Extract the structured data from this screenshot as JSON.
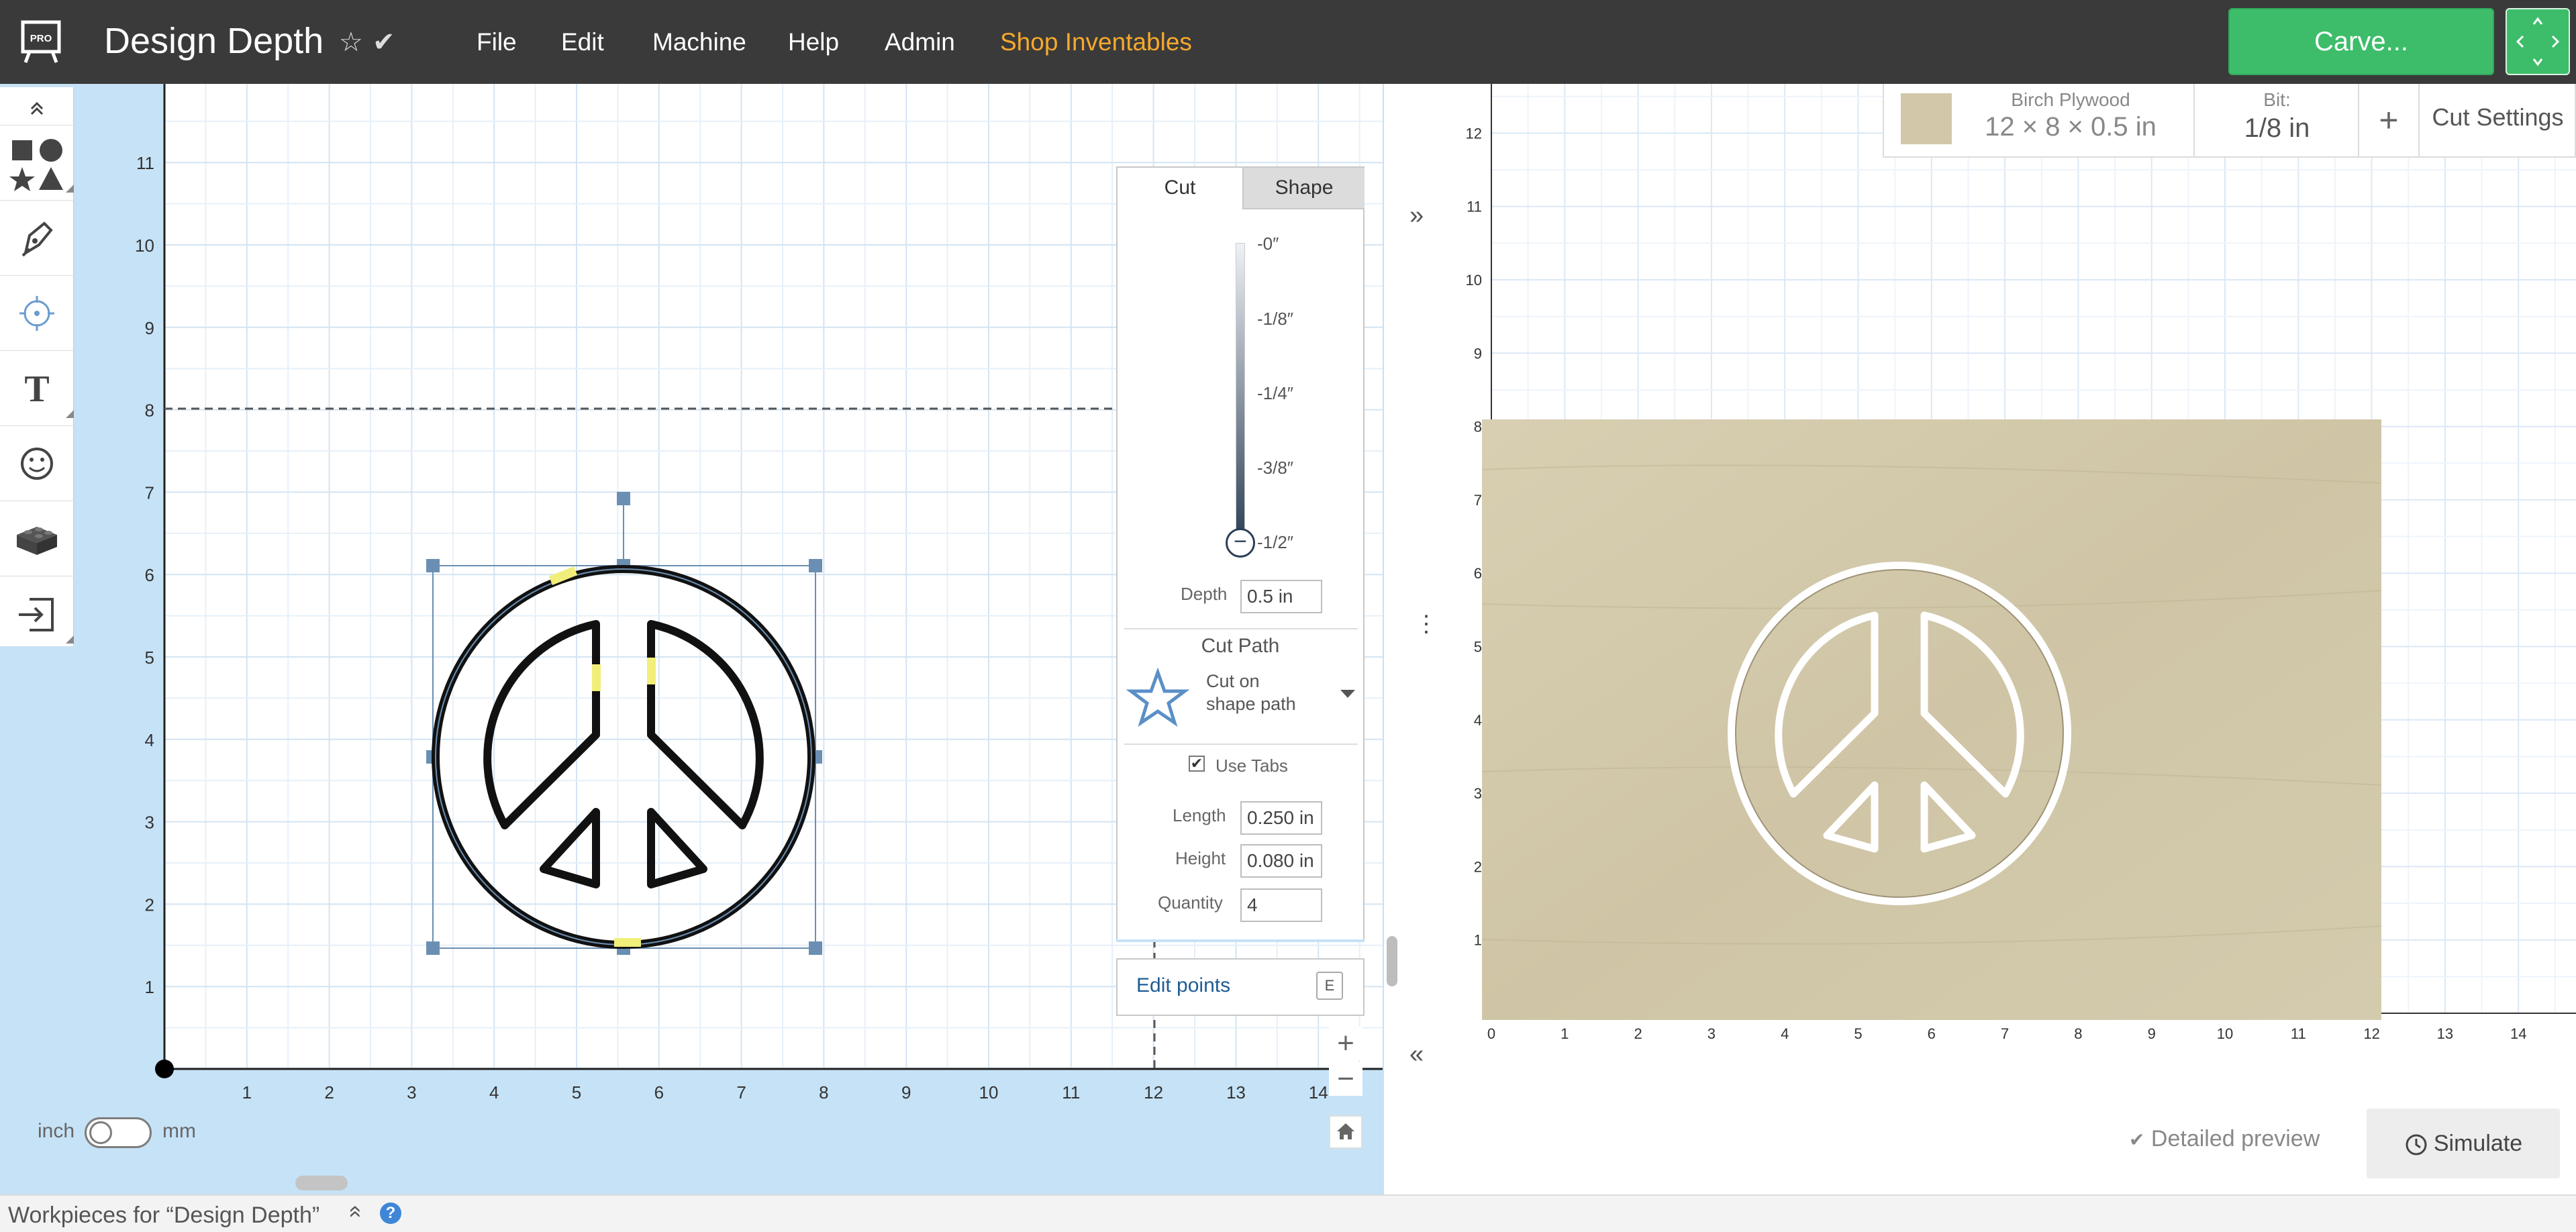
{
  "header": {
    "title": "Design Depth",
    "star_icon": "☆",
    "check_icon": "✔",
    "menu": [
      {
        "label": "File"
      },
      {
        "label": "Edit"
      },
      {
        "label": "Machine"
      },
      {
        "label": "Help"
      },
      {
        "label": "Admin"
      },
      {
        "label": "Shop Inventables"
      }
    ],
    "carve_label": "Carve...",
    "shop_color": "#f7a92d",
    "carve_color": "#3dbd6a"
  },
  "logo": {
    "text": "PRO"
  },
  "toolbox": {
    "icons": [
      "shapes-icon",
      "pen-icon",
      "point-icon",
      "text-icon",
      "emoji-icon",
      "box-icon",
      "import-icon"
    ],
    "text_tool_glyph": "T"
  },
  "design": {
    "y_ticks": [
      "11",
      "10",
      "9",
      "8",
      "7",
      "6",
      "5",
      "4",
      "3",
      "2",
      "1"
    ],
    "x_ticks": [
      "1",
      "2",
      "3",
      "4",
      "5",
      "6",
      "7",
      "8",
      "9",
      "10",
      "11",
      "12",
      "13",
      "14"
    ],
    "unit_inch": "inch",
    "unit_mm": "mm"
  },
  "cut_panel": {
    "tabs": [
      {
        "label": "Cut",
        "active": true
      },
      {
        "label": "Shape",
        "active": false
      }
    ],
    "depth_marks": [
      {
        "label": "-0″"
      },
      {
        "label": "-1/8″"
      },
      {
        "label": "-1/4″"
      },
      {
        "label": "-3/8″"
      },
      {
        "label": "-1/2″"
      }
    ],
    "depth_level_fraction": 1.0,
    "depth_label": "Depth",
    "depth_value": "0.5 in",
    "cut_path_title": "Cut Path",
    "cut_path_line1": "Cut on",
    "cut_path_line2": "shape path",
    "use_tabs_label": "Use Tabs",
    "use_tabs_checked": true,
    "length_label": "Length",
    "length_value": "0.250 in",
    "height_label": "Height",
    "height_value": "0.080 in",
    "quantity_label": "Quantity",
    "quantity_value": "4"
  },
  "edit_points": {
    "label": "Edit points",
    "shortcut": "E"
  },
  "preview": {
    "material_name": "Birch Plywood",
    "material_size": "12 × 8 × 0.5 in",
    "bit_label": "Bit:",
    "bit_value": "1/8 in",
    "add_label": "+",
    "cut_settings_label": "Cut Settings",
    "y_ticks": [
      "12",
      "11",
      "10",
      "9",
      "8",
      "7",
      "6",
      "5",
      "4",
      "3",
      "2",
      "1"
    ],
    "x_ticks": [
      "0",
      "1",
      "2",
      "3",
      "4",
      "5",
      "6",
      "7",
      "8",
      "9",
      "10",
      "11",
      "12",
      "13",
      "14"
    ],
    "detailed_preview_label": "Detailed preview",
    "simulate_label": "Simulate",
    "wood_color": "#d2c8a9"
  },
  "footer": {
    "workpieces_label": "Workpieces for “Design Depth”",
    "chevron": "»",
    "help": "?"
  }
}
